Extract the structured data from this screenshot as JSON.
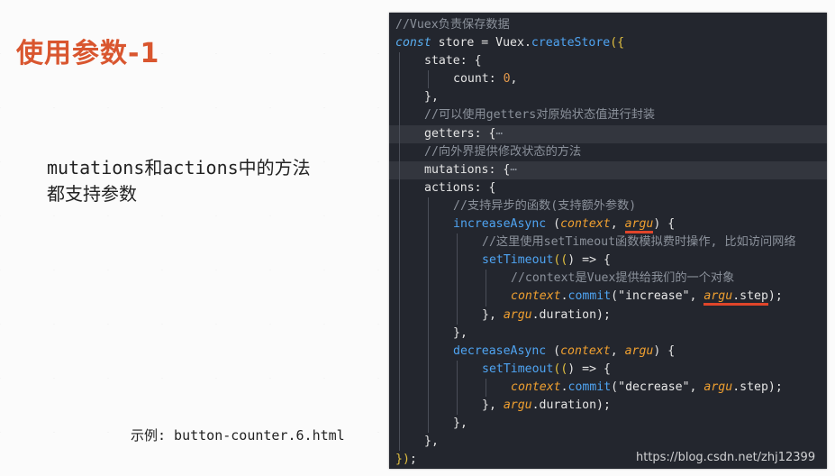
{
  "slide": {
    "title": "使用参数-1",
    "description_line1": "mutations和actions中的方法",
    "description_line2": "都支持参数",
    "example": "示例: button-counter.6.html"
  },
  "watermark": "https://blog.csdn.net/zhj12399",
  "colors": {
    "title": "#d9562f",
    "code_background": "#23262e",
    "underline_mark": "#e0452a"
  },
  "code": {
    "lines": [
      {
        "indent": 0,
        "tokens": [
          {
            "t": "//Vuex负责保存数据",
            "c": "comment"
          }
        ]
      },
      {
        "indent": 0,
        "tokens": [
          {
            "t": "const",
            "c": "kw"
          },
          {
            "t": " store = ",
            "c": "plain"
          },
          {
            "t": "Vuex",
            "c": "plain"
          },
          {
            "t": ".",
            "c": "plain"
          },
          {
            "t": "createStore",
            "c": "fn"
          },
          {
            "t": "({",
            "c": "paren"
          }
        ]
      },
      {
        "indent": 1,
        "tokens": [
          {
            "t": "state",
            "c": "prop"
          },
          {
            "t": ": {",
            "c": "plain"
          }
        ]
      },
      {
        "indent": 2,
        "tokens": [
          {
            "t": "count",
            "c": "prop"
          },
          {
            "t": ": ",
            "c": "plain"
          },
          {
            "t": "0",
            "c": "num"
          },
          {
            "t": ",",
            "c": "plain"
          }
        ]
      },
      {
        "indent": 1,
        "tokens": [
          {
            "t": "},",
            "c": "plain"
          }
        ]
      },
      {
        "indent": 1,
        "tokens": [
          {
            "t": "//可以使用getters对原始状态值进行封装",
            "c": "comment"
          }
        ]
      },
      {
        "indent": 1,
        "highlight": true,
        "tokens": [
          {
            "t": "getters",
            "c": "prop"
          },
          {
            "t": ": {",
            "c": "plain"
          },
          {
            "t": "⋯",
            "c": "fold"
          }
        ]
      },
      {
        "indent": 1,
        "tokens": [
          {
            "t": "//向外界提供修改状态的方法",
            "c": "comment"
          }
        ]
      },
      {
        "indent": 1,
        "highlight": true,
        "tokens": [
          {
            "t": "mutations",
            "c": "prop"
          },
          {
            "t": ": {",
            "c": "plain"
          },
          {
            "t": "⋯",
            "c": "fold"
          }
        ]
      },
      {
        "indent": 1,
        "tokens": [
          {
            "t": "actions",
            "c": "prop"
          },
          {
            "t": ": {",
            "c": "plain"
          }
        ]
      },
      {
        "indent": 2,
        "tokens": [
          {
            "t": "//支持异步的函数(支持额外参数)",
            "c": "comment"
          }
        ]
      },
      {
        "indent": 2,
        "tokens": [
          {
            "t": "increaseAsync",
            "c": "fn"
          },
          {
            "t": " (",
            "c": "plain"
          },
          {
            "t": "context",
            "c": "param"
          },
          {
            "t": ", ",
            "c": "plain"
          },
          {
            "t": "argu",
            "c": "param",
            "mark": true
          },
          {
            "t": ") {",
            "c": "plain"
          }
        ]
      },
      {
        "indent": 3,
        "tokens": [
          {
            "t": "//这里使用setTimeout函数模拟费时操作, 比如访问网络",
            "c": "comment"
          }
        ]
      },
      {
        "indent": 3,
        "tokens": [
          {
            "t": "setTimeout",
            "c": "fn"
          },
          {
            "t": "((",
            "c": "paren"
          },
          {
            "t": ") => {",
            "c": "plain"
          }
        ]
      },
      {
        "indent": 4,
        "tokens": [
          {
            "t": "//context是Vuex提供给我们的一个对象",
            "c": "comment"
          }
        ]
      },
      {
        "indent": 4,
        "tokens": [
          {
            "t": "context",
            "c": "param"
          },
          {
            "t": ".",
            "c": "plain"
          },
          {
            "t": "commit",
            "c": "fn"
          },
          {
            "t": "(",
            "c": "plain"
          },
          {
            "t": "\"increase\"",
            "c": "str"
          },
          {
            "t": ", ",
            "c": "plain"
          },
          {
            "t": "argu",
            "c": "param",
            "mark": true
          },
          {
            "t": ".step",
            "c": "plain",
            "mark": true
          },
          {
            "t": ");",
            "c": "plain"
          }
        ]
      },
      {
        "indent": 3,
        "tokens": [
          {
            "t": "}, ",
            "c": "plain"
          },
          {
            "t": "argu",
            "c": "param"
          },
          {
            "t": ".duration);",
            "c": "plain"
          }
        ]
      },
      {
        "indent": 2,
        "tokens": [
          {
            "t": "},",
            "c": "plain"
          }
        ]
      },
      {
        "indent": 2,
        "tokens": [
          {
            "t": "decreaseAsync",
            "c": "fn"
          },
          {
            "t": " (",
            "c": "plain"
          },
          {
            "t": "context",
            "c": "param"
          },
          {
            "t": ", ",
            "c": "plain"
          },
          {
            "t": "argu",
            "c": "param"
          },
          {
            "t": ") {",
            "c": "plain"
          }
        ]
      },
      {
        "indent": 3,
        "tokens": [
          {
            "t": "setTimeout",
            "c": "fn"
          },
          {
            "t": "((",
            "c": "paren"
          },
          {
            "t": ") => {",
            "c": "plain"
          }
        ]
      },
      {
        "indent": 4,
        "tokens": [
          {
            "t": "context",
            "c": "param"
          },
          {
            "t": ".",
            "c": "plain"
          },
          {
            "t": "commit",
            "c": "fn"
          },
          {
            "t": "(",
            "c": "plain"
          },
          {
            "t": "\"decrease\"",
            "c": "str"
          },
          {
            "t": ", ",
            "c": "plain"
          },
          {
            "t": "argu",
            "c": "param"
          },
          {
            "t": ".step);",
            "c": "plain"
          }
        ]
      },
      {
        "indent": 3,
        "tokens": [
          {
            "t": "}, ",
            "c": "plain"
          },
          {
            "t": "argu",
            "c": "param"
          },
          {
            "t": ".duration);",
            "c": "plain"
          }
        ]
      },
      {
        "indent": 2,
        "tokens": [
          {
            "t": "},",
            "c": "plain"
          }
        ]
      },
      {
        "indent": 1,
        "tokens": [
          {
            "t": "},",
            "c": "plain"
          }
        ]
      },
      {
        "indent": 0,
        "tokens": [
          {
            "t": "})",
            "c": "paren"
          },
          {
            "t": ";",
            "c": "plain"
          }
        ]
      }
    ]
  }
}
